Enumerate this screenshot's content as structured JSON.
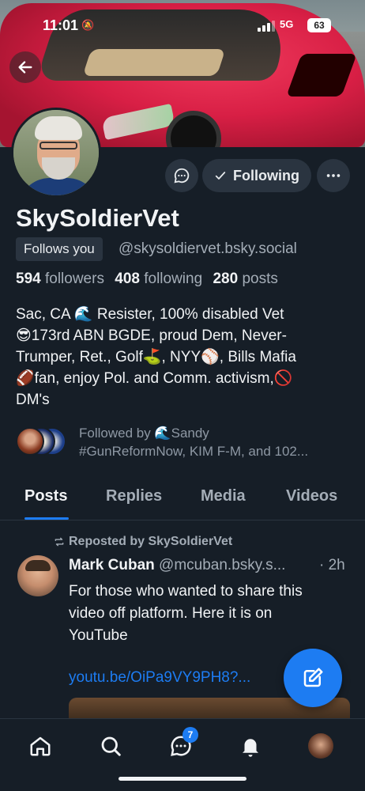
{
  "status_bar": {
    "time": "11:01",
    "network": "5G",
    "battery": "63"
  },
  "profile": {
    "display_name": "SkySoldierVet",
    "follows_you": "Follows you",
    "handle": "@skysoldiervet.bsky.social",
    "followers_count": "594",
    "followers_label": "followers",
    "following_count": "408",
    "following_label": "following",
    "posts_count": "280",
    "posts_label": "posts",
    "bio_lines": [
      "Sac, CA 🌊 Resister, 100% disabled Vet",
      "😎173rd ABN BGDE, proud Dem, Never-",
      "Trumper, Ret., Golf⛳, NYY⚾, Bills Mafia",
      "🏈fan, enjoy Pol. and Comm. activism,🚫",
      "DM's"
    ],
    "followed_by_line1": "Followed by 🌊Sandy",
    "followed_by_line2": "#GunReformNow, KIM F-M, and 102..."
  },
  "actions": {
    "following_label": "Following"
  },
  "tabs": [
    {
      "label": "Posts",
      "active": true
    },
    {
      "label": "Replies",
      "active": false
    },
    {
      "label": "Media",
      "active": false
    },
    {
      "label": "Videos",
      "active": false
    }
  ],
  "post": {
    "repost_label": "Reposted by SkySoldierVet",
    "author": "Mark Cuban",
    "handle": "@mcuban.bsky.s...",
    "time": "· 2h",
    "text_lines": [
      "For those who wanted to share this",
      "video off platform. Here it is on",
      "YouTube"
    ],
    "link": "youtu.be/OiPa9VY9PH8?..."
  },
  "bottom_nav": {
    "chat_badge": "7"
  },
  "colors": {
    "background": "#161e27",
    "accent": "#1d7cf2",
    "surface": "#2a3440",
    "muted_text": "#a4adb7"
  },
  "icons": [
    "back-arrow-icon",
    "chat-bubble-icon",
    "check-icon",
    "more-icon",
    "repost-icon",
    "compose-icon",
    "home-icon",
    "search-icon",
    "chat-icon",
    "bell-icon"
  ]
}
